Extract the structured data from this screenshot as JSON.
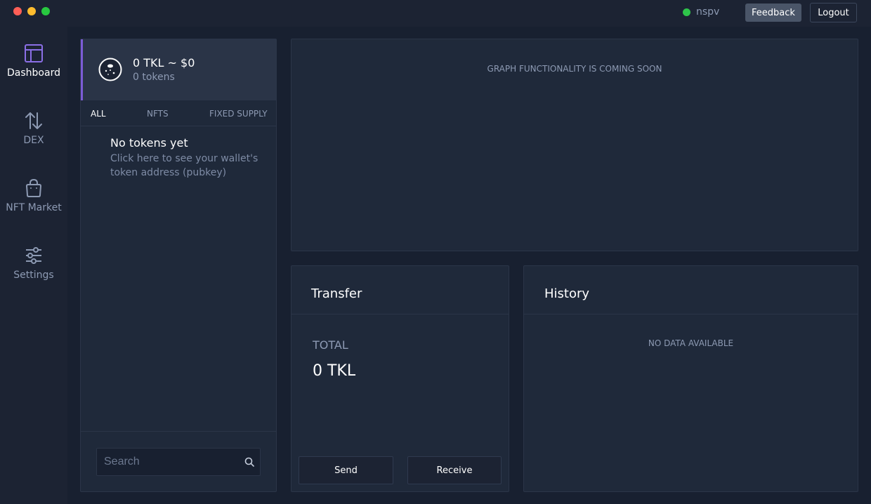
{
  "topbar": {
    "network_label": "nspv",
    "network_status_color": "#2ec44a",
    "feedback_label": "Feedback",
    "logout_label": "Logout"
  },
  "sidebar": {
    "items": [
      {
        "label": "Dashboard",
        "icon": "dashboard-icon",
        "active": true
      },
      {
        "label": "DEX",
        "icon": "swap-arrows-icon",
        "active": false
      },
      {
        "label": "NFT Market",
        "icon": "shopping-bag-icon",
        "active": false
      },
      {
        "label": "Settings",
        "icon": "sliders-icon",
        "active": false
      }
    ]
  },
  "tokens": {
    "balance": "0 TKL ~ $0",
    "token_count": "0 tokens",
    "tabs": [
      {
        "label": "ALL",
        "active": true
      },
      {
        "label": "NFTS",
        "active": false
      },
      {
        "label": "FIXED SUPPLY",
        "active": false
      }
    ],
    "empty_title": "No tokens yet",
    "empty_link": "Click here to see your wallet's token address (pubkey)",
    "search_placeholder": "Search"
  },
  "graph": {
    "message": "GRAPH FUNCTIONALITY IS COMING SOON"
  },
  "transfer": {
    "title": "Transfer",
    "total_label": "TOTAL",
    "total_value": "0 TKL",
    "send_label": "Send",
    "receive_label": "Receive"
  },
  "history": {
    "title": "History",
    "empty_message": "NO DATA AVAILABLE"
  },
  "colors": {
    "accent": "#7c5cd6",
    "background": "#1c2333",
    "panel": "#1f293a"
  }
}
